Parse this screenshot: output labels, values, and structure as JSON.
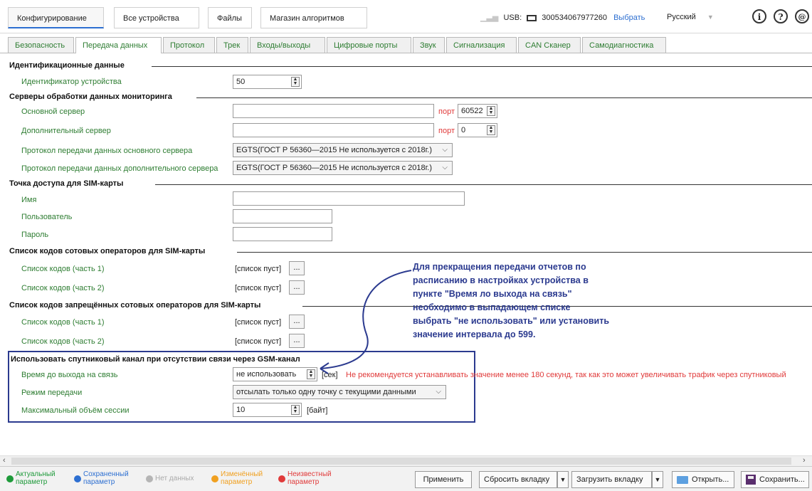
{
  "topbar": {
    "menu": [
      "Конфигурирование",
      "Все устройства",
      "Файлы",
      "Магазин алгоритмов"
    ],
    "usb_label": "USB:",
    "usb_serial": "300534067977260",
    "select_link": "Выбрать",
    "language": "Русский",
    "icons": [
      "info-icon",
      "help-icon",
      "at-icon"
    ]
  },
  "tabs": [
    "Безопасность",
    "Передача данных",
    "Протокол",
    "Трек",
    "Входы/выходы",
    "Цифровые порты",
    "Звук",
    "Сигнализация",
    "CAN Сканер",
    "Самодиагностика"
  ],
  "active_tab": "Передача данных",
  "sections": {
    "identification": {
      "title": "Идентификационные данные",
      "device_id_label": "Идентификатор устройства",
      "device_id_value": "50"
    },
    "servers": {
      "title": "Серверы обработки данных мониторинга",
      "main_server_label": "Основной сервер",
      "main_server_value": "",
      "main_port_label": "порт",
      "main_port_value": "60522",
      "backup_server_label": "Дополнительный сервер",
      "backup_server_value": "",
      "backup_port_label": "порт",
      "backup_port_value": "0",
      "main_protocol_label": "Протокол передачи данных основного сервера",
      "main_protocol_value": "EGTS(ГОСТ Р 56360—2015 Не используется с 2018г.)",
      "backup_protocol_label": "Протокол передачи данных дополнительного сервера",
      "backup_protocol_value": "EGTS(ГОСТ Р 56360—2015 Не используется с 2018г.)"
    },
    "apn": {
      "title": "Точка доступа для SIM-карты",
      "name_label": "Имя",
      "user_label": "Пользователь",
      "password_label": "Пароль"
    },
    "operators": {
      "title": "Список кодов сотовых операторов для SIM-карты",
      "part1_label": "Список кодов (часть 1)",
      "part1_value": "[список пуст]",
      "part2_label": "Список кодов (часть 2)",
      "part2_value": "[список пуст]"
    },
    "forbidden": {
      "title": "Список кодов запрещённых сотовых операторов для SIM-карты",
      "part1_label": "Список кодов (часть 1)",
      "part1_value": "[список пуст]",
      "part2_label": "Список кодов (часть 2)",
      "part2_value": "[список пуст]"
    },
    "satellite": {
      "title": "Использовать спутниковый канал при отсутствии связи через GSM-канал",
      "time_label": "Время до выхода на связь",
      "time_value": "не использовать",
      "time_unit": "[сек]",
      "warning": "Не рекомендуется устанавливать значение менее 180 секунд, так как это может увеличивать трафик через спутниковый",
      "mode_label": "Режим передачи",
      "mode_value": "отсылать только одну точку с текущими данными",
      "session_label": "Максимальный объём сессии",
      "session_value": "10",
      "session_unit": "[байт]"
    }
  },
  "callout": [
    "Для прекращения передачи отчетов по",
    "расписанию в настройках устройства в",
    "пункте \"Время ло выхода на связь\"",
    "необходимо в выпадающем списке",
    "выбрать \"не использовать\" или установить",
    "значение интервала до 599."
  ],
  "legend": [
    {
      "line1": "Актуальный",
      "line2": "параметр",
      "color": "#1e9a3a"
    },
    {
      "line1": "Сохраненный",
      "line2": "параметр",
      "color": "#2d6fd1"
    },
    {
      "line1": "Нет данных",
      "line2": "",
      "color": "#b5b5b5"
    },
    {
      "line1": "Изменённый",
      "line2": "параметр",
      "color": "#f0a020"
    },
    {
      "line1": "Неизвестный",
      "line2": "параметр",
      "color": "#e03a3a"
    }
  ],
  "buttons": {
    "apply": "Применить",
    "reset_tab": "Сбросить вкладку",
    "load_tab": "Загрузить вкладку",
    "open": "Открыть...",
    "save": "Сохранить..."
  },
  "colors": {
    "label_green": "#2e7d32",
    "callout_blue": "#2b3a8f",
    "warning_red": "#e03a3a",
    "link_blue": "#2d6fd1"
  }
}
